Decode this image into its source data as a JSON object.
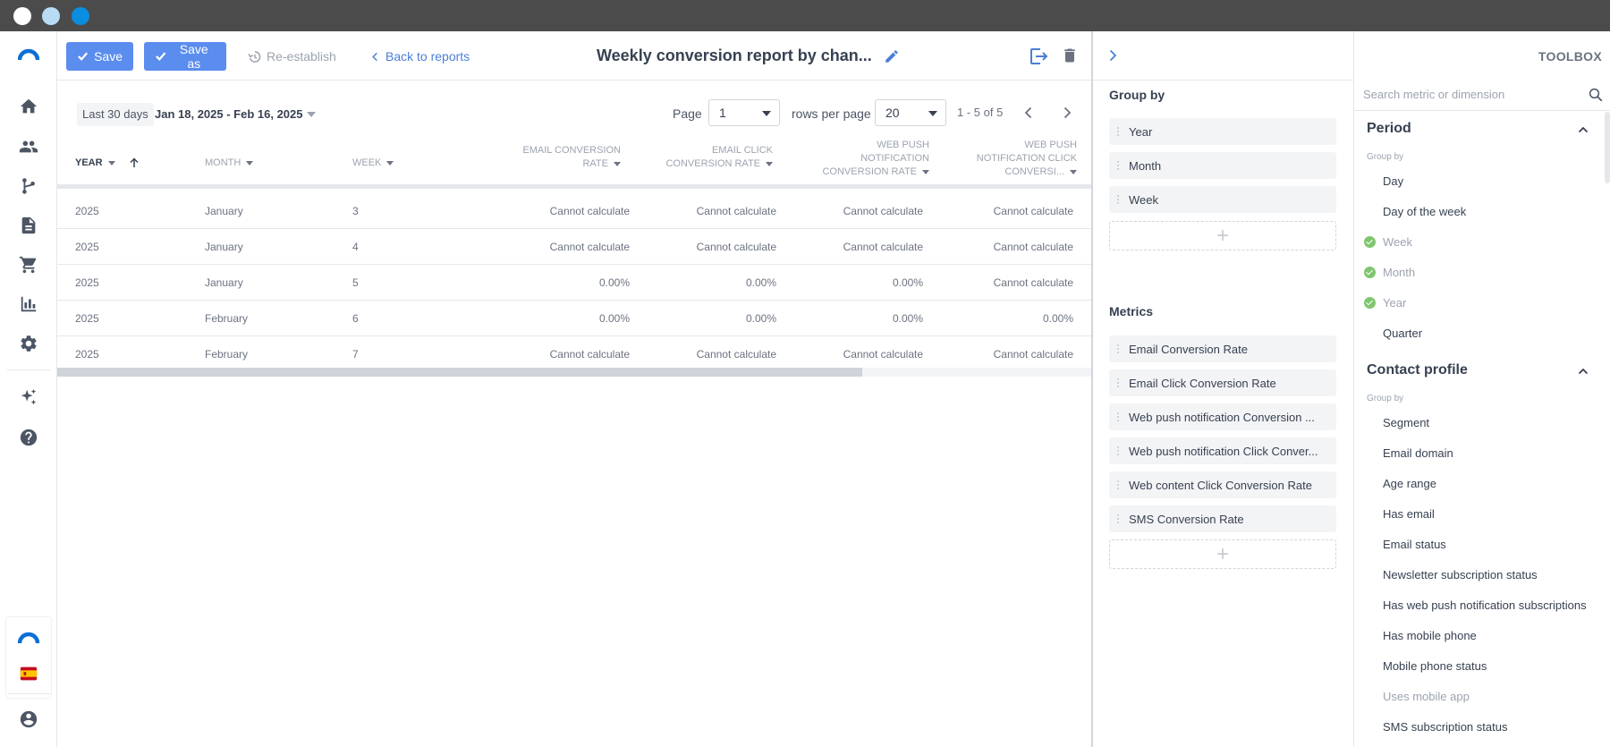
{
  "toolbar": {
    "save_label": "Save",
    "save_as_label": "Save as",
    "reestablish_label": "Re-establish",
    "back_label": "Back to reports",
    "title": "Weekly conversion report by chan..."
  },
  "filters": {
    "preset": "Last 30 days",
    "range": "Jan 18, 2025 - Feb 16, 2025"
  },
  "pagination": {
    "page_label": "Page",
    "page_value": "1",
    "rows_label": "rows per page",
    "rows_value": "20",
    "range_text": "1 - 5 of 5"
  },
  "table": {
    "columns": [
      "Year",
      "Month",
      "Week",
      "Email Conversion Rate",
      "Email Click Conversion Rate",
      "Web Push Notification Conversion Rate",
      "Web Push Notification Click Conversi..."
    ],
    "rows": [
      [
        "2025",
        "January",
        "3",
        "Cannot calculate",
        "Cannot calculate",
        "Cannot calculate",
        "Cannot calculate"
      ],
      [
        "2025",
        "January",
        "4",
        "Cannot calculate",
        "Cannot calculate",
        "Cannot calculate",
        "Cannot calculate"
      ],
      [
        "2025",
        "January",
        "5",
        "0.00%",
        "0.00%",
        "0.00%",
        "Cannot calculate"
      ],
      [
        "2025",
        "February",
        "6",
        "0.00%",
        "0.00%",
        "0.00%",
        "0.00%"
      ],
      [
        "2025",
        "February",
        "7",
        "Cannot calculate",
        "Cannot calculate",
        "Cannot calculate",
        "Cannot calculate"
      ]
    ]
  },
  "group_panel": {
    "group_by_title": "Group by",
    "group_by": [
      "Year",
      "Month",
      "Week"
    ],
    "metrics_title": "Metrics",
    "metrics": [
      "Email Conversion Rate",
      "Email Click Conversion Rate",
      "Web push notification Conversion ...",
      "Web push notification Click Conver...",
      "Web content Click Conversion Rate",
      "SMS Conversion Rate"
    ]
  },
  "toolbox": {
    "title": "TOOLBOX",
    "search_placeholder": "Search metric or dimension",
    "period": {
      "title": "Period",
      "subtitle": "Group by",
      "items": [
        "Day",
        "Day of the week",
        "Week",
        "Month",
        "Year",
        "Quarter"
      ],
      "checked": [
        false,
        false,
        true,
        true,
        true,
        false
      ]
    },
    "contact_profile": {
      "title": "Contact profile",
      "subtitle": "Group by",
      "items": [
        "Segment",
        "Email domain",
        "Age range",
        "Has email",
        "Email status",
        "Newsletter subscription status",
        "Has web push notification subscriptions",
        "Has mobile phone",
        "Mobile phone status",
        "Uses mobile app",
        "SMS subscription status"
      ]
    }
  },
  "colors": {
    "primary": "#5b8def",
    "link": "#4a7fd6",
    "check": "#7fc66e",
    "brand": "#0b6fd6"
  }
}
